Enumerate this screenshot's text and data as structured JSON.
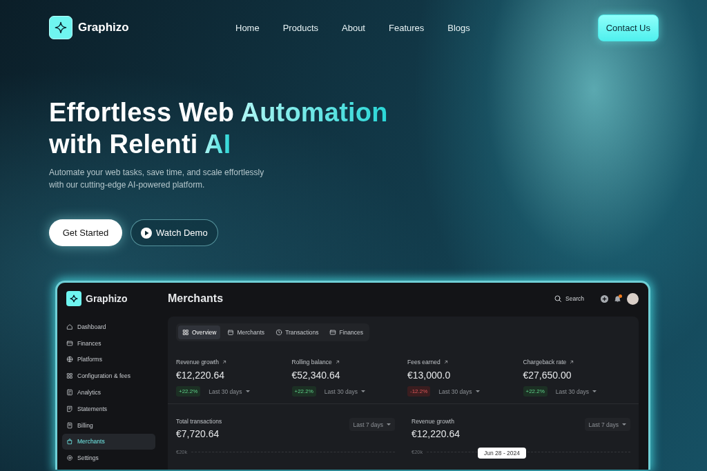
{
  "nav": {
    "brand": "Graphizo",
    "links": [
      {
        "label": "Home"
      },
      {
        "label": "Products"
      },
      {
        "label": "About"
      },
      {
        "label": "Features"
      },
      {
        "label": "Blogs"
      }
    ],
    "cta": "Contact Us"
  },
  "hero": {
    "title_lines": [
      [
        {
          "text": "Effortless ",
          "accent": false
        },
        {
          "text": "Web ",
          "accent": false
        },
        {
          "text": "Automation",
          "accent": true
        }
      ],
      [
        {
          "text": "with Relenti ",
          "accent": false
        },
        {
          "text": "AI",
          "accent": true
        }
      ]
    ],
    "subtitle": "Automate your web tasks, save time, and scale effortlessly with our cutting-edge AI-powered platform.",
    "primary_button": "Get Started",
    "secondary_button": "Watch Demo"
  },
  "dashboard": {
    "brand": "Graphizo",
    "page_title": "Merchants",
    "search": {
      "placeholder": "Search"
    },
    "sidebar": {
      "items": [
        {
          "label": "Dashboard",
          "selected": false
        },
        {
          "label": "Finances",
          "selected": false
        },
        {
          "label": "Platforms",
          "selected": false
        },
        {
          "label": "Configuration & fees",
          "selected": false
        },
        {
          "label": "Analytics",
          "selected": false
        },
        {
          "label": "Statements",
          "selected": false
        },
        {
          "label": "Billing",
          "selected": false
        },
        {
          "label": "Merchants",
          "selected": true
        },
        {
          "label": "Settings",
          "selected": false
        }
      ]
    },
    "tabs": [
      {
        "label": "Overview",
        "selected": true
      },
      {
        "label": "Merchants",
        "selected": false
      },
      {
        "label": "Transactions",
        "selected": false
      },
      {
        "label": "Finances",
        "selected": false
      }
    ],
    "stats": [
      {
        "label": "Revenue growth",
        "value": "€12,220.64",
        "change": "+22.2%",
        "kind": "up",
        "period": "Last 30 days"
      },
      {
        "label": "Rolling balance",
        "value": "€52,340.64",
        "change": "+22.2%",
        "kind": "up",
        "period": "Last 30 days"
      },
      {
        "label": "Fees earned",
        "value": "€13,000.0",
        "change": "-12.2%",
        "kind": "down",
        "period": "Last 30 days"
      },
      {
        "label": "Chargeback rate",
        "value": "€27,650.00",
        "change": "+22.2%",
        "kind": "up",
        "period": "Last 30 days"
      }
    ],
    "charts": [
      {
        "label": "Total transactions",
        "value": "€7,720.64",
        "period": "Last 7 days",
        "axis_label": "€20k"
      },
      {
        "label": "Revenue growth",
        "value": "€12,220.64",
        "period": "Last 7 days",
        "axis_label": "€20k",
        "tooltip": "Jun 28 - 2024"
      }
    ]
  }
}
